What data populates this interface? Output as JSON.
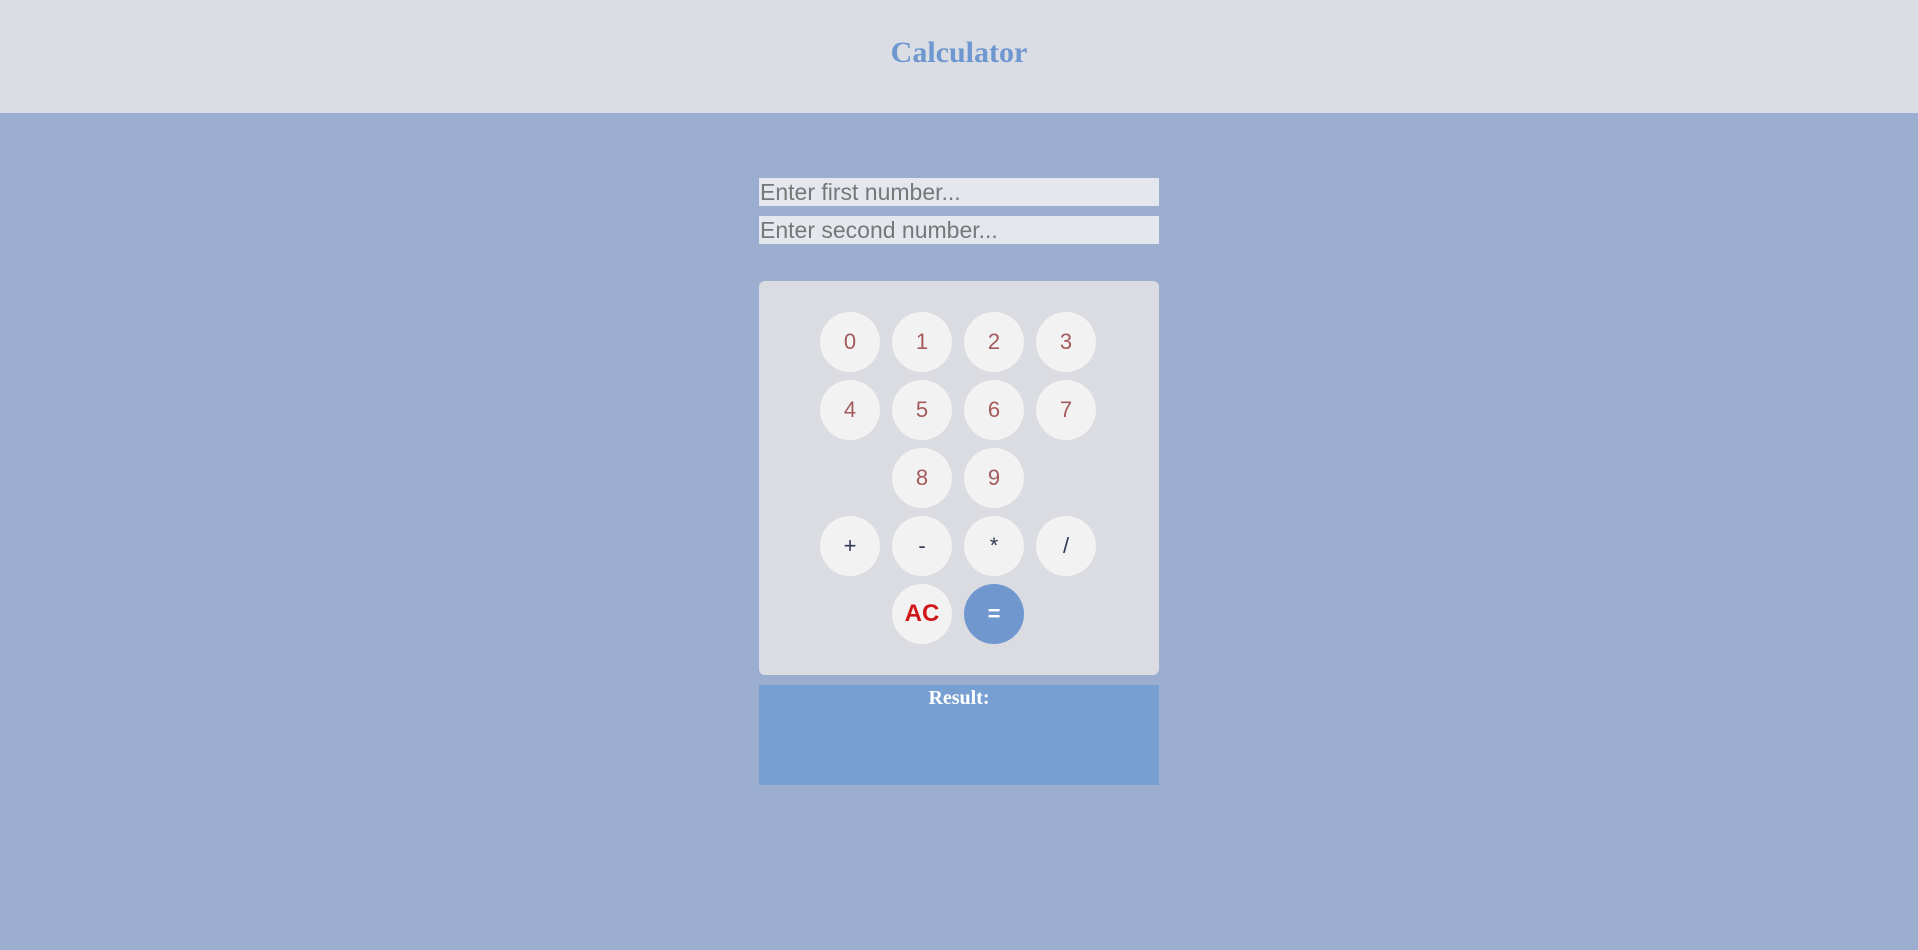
{
  "header": {
    "title": "Calculator"
  },
  "inputs": {
    "first": {
      "value": "",
      "placeholder": "Enter first number..."
    },
    "second": {
      "value": "",
      "placeholder": "Enter second number..."
    }
  },
  "keypad": {
    "digits": [
      "0",
      "1",
      "2",
      "3",
      "4",
      "5",
      "6",
      "7",
      "8",
      "9"
    ],
    "operators": [
      "+",
      "-",
      "*",
      "/"
    ],
    "clear_label": "AC",
    "equals_label": "="
  },
  "result": {
    "label": "Result:",
    "value": ""
  },
  "colors": {
    "page_background": "#9caecf",
    "header_background": "#dadde4",
    "title": "#6f97cf",
    "keypad_background": "#dadce2",
    "digit_text": "#a45a5a",
    "clear_text": "#d01818",
    "equals_background": "#7098cf",
    "result_background": "#789fd2"
  }
}
